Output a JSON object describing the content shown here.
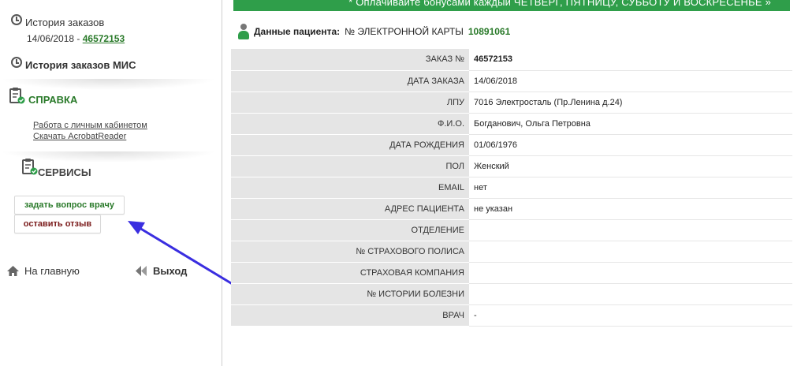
{
  "sidebar": {
    "order_history": {
      "title": "История заказов",
      "date": "14/06/2018 - ",
      "order_link": "46572153"
    },
    "mis_history": {
      "title": "История заказов МИС"
    },
    "help": {
      "title": "СПРАВКА",
      "links": [
        "Работа с личным кабинетом",
        "Скачать AcrobatReader"
      ]
    },
    "services": {
      "title": "СЕРВИСЫ",
      "ask_doctor": "задать вопрос врачу",
      "leave_review": "оставить отзыв"
    },
    "nav": {
      "home": "На главную",
      "logout": "Выход"
    }
  },
  "banner": {
    "text": "* Оплачивайте бонусами каждый ЧЕТВЕРГ, ПЯТНИЦУ, СУББОТУ И ВОСКРЕСЕНЬЕ »"
  },
  "patient": {
    "label": "Данные пациента:",
    "card_label": "№ ЭЛЕКТРОННОЙ КАРТЫ",
    "card_number": "10891061"
  },
  "details": [
    {
      "label": "ЗАКАЗ №",
      "value": "46572153"
    },
    {
      "label": "ДАТА ЗАКАЗА",
      "value": "14/06/2018"
    },
    {
      "label": "ЛПУ",
      "value": "7016 Электросталь (Пр.Ленина д.24)"
    },
    {
      "label": "Ф.И.О.",
      "value": "Богданович, Ольга Петровна"
    },
    {
      "label": "ДАТА РОЖДЕНИЯ",
      "value": "01/06/1976"
    },
    {
      "label": "ПОЛ",
      "value": "Женский"
    },
    {
      "label": "EMAIL",
      "value": "нет"
    },
    {
      "label": "АДРЕС ПАЦИЕНТА",
      "value": "не указан"
    },
    {
      "label": "ОТДЕЛЕНИЕ",
      "value": ""
    },
    {
      "label": "№ СТРАХОВОГО ПОЛИСА",
      "value": ""
    },
    {
      "label": "СТРАХОВАЯ КОМПАНИЯ",
      "value": ""
    },
    {
      "label": "№ ИСТОРИИ БОЛЕЗНИ",
      "value": ""
    },
    {
      "label": "ВРАЧ",
      "value": "-"
    }
  ],
  "colors": {
    "accent_green": "#2f9e4a",
    "link_green": "#2a7a2a",
    "review_red": "#7a1a1a",
    "annotation_arrow": "#3a2ee0"
  }
}
